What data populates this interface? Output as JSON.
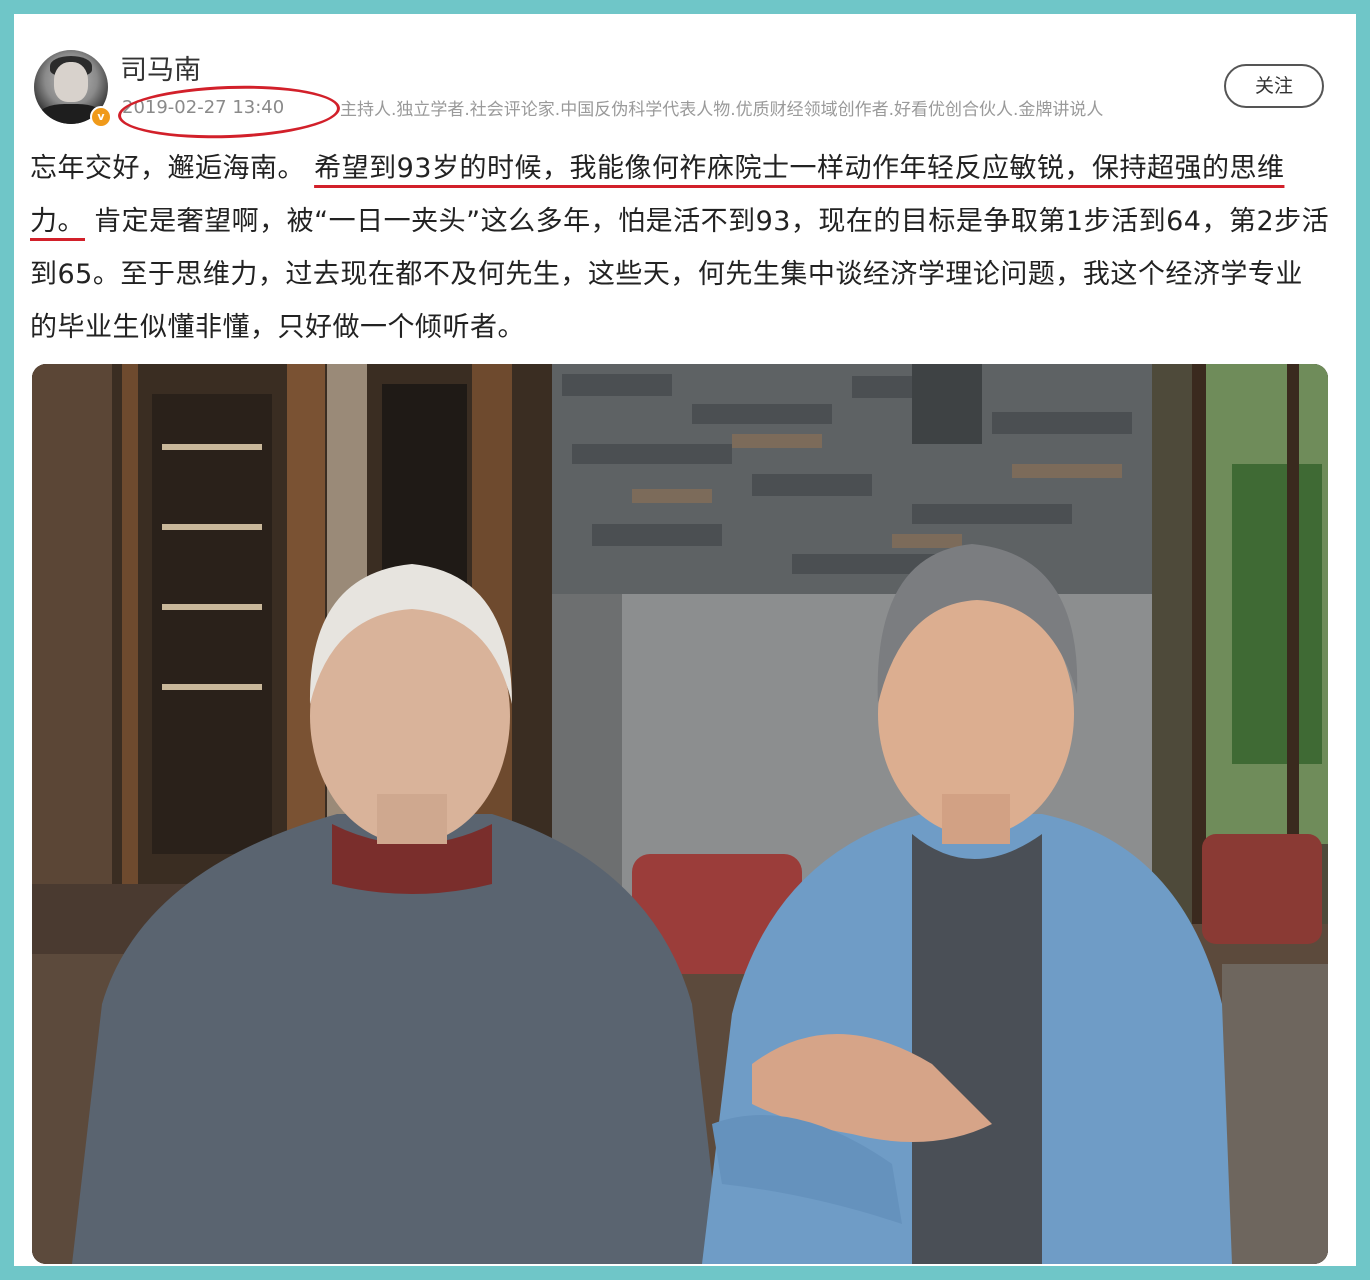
{
  "post": {
    "author": "司马南",
    "verified_badge": "v",
    "timestamp": "2019-02-27 13:40",
    "bio": "主持人.独立学者.社会评论家.中国反伪科学代表人物.优质财经领域创作者.好看优创合伙人.金牌讲说人",
    "follow_label": "关注",
    "text": {
      "part1": "忘年交好，邂逅海南。",
      "highlight1": "希望到93岁的时候，我能像何祚庥院士一样动作年轻反应敏锐，保持超强的思维力。",
      "part2": "肯定是奢望啊，被“一日一夹头”这么多年，怕是活不到93，现在的目标是争取第1步活到64，第2步活到65。至于思维力，过去现在都不及何先生，这些天，何先生集中谈经济学理论问题，我这个经济学专业的毕业生似懂非懂，只好做一个倾听者。"
    }
  },
  "colors": {
    "frame": "#6fc6c8",
    "annotation": "#d2202a",
    "text": "#222222",
    "meta": "#8a8a8a"
  }
}
